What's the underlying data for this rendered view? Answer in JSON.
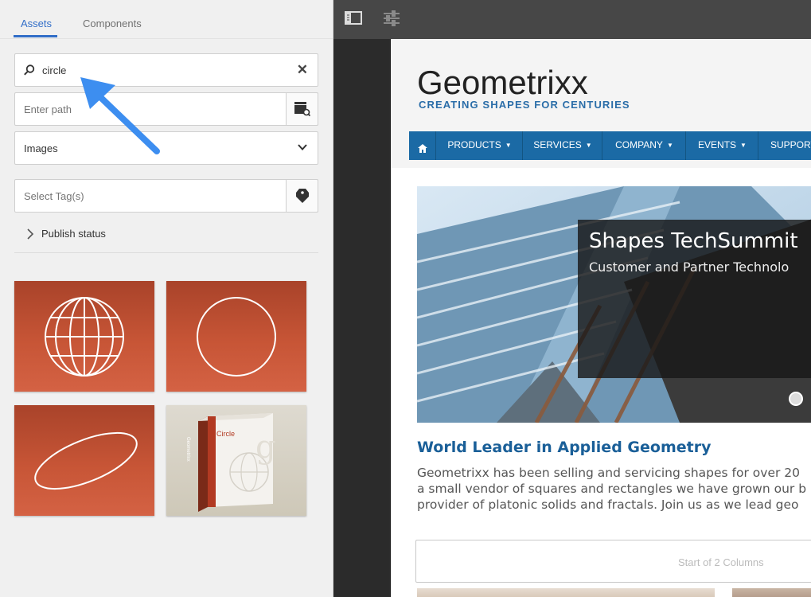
{
  "tabs": [
    {
      "label": "Assets"
    },
    {
      "label": "Components"
    }
  ],
  "search": {
    "value": "circle"
  },
  "path": {
    "placeholder": "Enter path"
  },
  "type_select": {
    "selected": "Images"
  },
  "tags": {
    "placeholder": "Select Tag(s)"
  },
  "publish_status": {
    "label": "Publish status"
  },
  "assets": [
    {
      "name": "globe-asset",
      "icon": "globe"
    },
    {
      "name": "circle-asset",
      "icon": "circle"
    },
    {
      "name": "ellipse-asset",
      "icon": "ellipse"
    },
    {
      "name": "circle-box-asset",
      "icon": "product-box",
      "box_title": "Circle",
      "box_brand": "Geometrixx"
    }
  ],
  "page": {
    "logo": "Geometrixx",
    "tagline": "CREATING SHAPES FOR CENTURIES",
    "nav": [
      {
        "label": "PRODUCTS"
      },
      {
        "label": "SERVICES"
      },
      {
        "label": "COMPANY"
      },
      {
        "label": "EVENTS"
      },
      {
        "label": "SUPPORT"
      }
    ],
    "hero": {
      "title": "Shapes TechSummit",
      "subtitle": "Customer and Partner Technolo"
    },
    "heading": "World Leader in Applied Geometry",
    "paragraph": [
      "Geometrixx has been selling and servicing shapes for over 20",
      "a small vendor of squares and rectangles we have grown our b",
      "provider of platonic solids and fractals. Join us as we lead geo"
    ],
    "columns_placeholder": "Start of 2 Columns"
  },
  "colors": {
    "accent": "#326ec8",
    "nav": "#1b6aa5",
    "asset_red": "#c75536",
    "arrow": "#3d8ef0"
  }
}
